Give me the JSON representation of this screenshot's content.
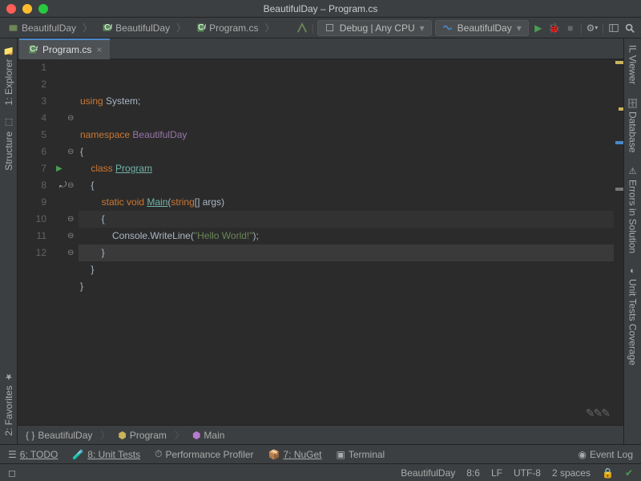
{
  "title": "BeautifulDay – Program.cs",
  "breadcrumbs": [
    "BeautifulDay",
    "BeautifulDay",
    "Program.cs"
  ],
  "config": {
    "debug": "Debug | Any CPU",
    "project": "BeautifulDay"
  },
  "tab": {
    "name": "Program.cs"
  },
  "left_tools": [
    "1: Explorer",
    "Structure",
    "2: Favorites"
  ],
  "right_tools": [
    "IL Viewer",
    "Database",
    "Errors in Solution",
    "Unit Tests Coverage"
  ],
  "code": {
    "lines": [
      {
        "n": 1,
        "tokens": [
          [
            "kw",
            "using"
          ],
          [
            "",
            " "
          ],
          [
            "cls",
            "System"
          ],
          [
            "",
            ";"
          ]
        ],
        "indent": 0
      },
      {
        "n": 2,
        "tokens": [],
        "indent": 0
      },
      {
        "n": 3,
        "tokens": [
          [
            "kw",
            "namespace"
          ],
          [
            "",
            " "
          ],
          [
            "ident",
            "BeautifulDay"
          ]
        ],
        "indent": 0
      },
      {
        "n": 4,
        "tokens": [
          [
            "",
            "{"
          ]
        ],
        "indent": 0,
        "fold": "⊖"
      },
      {
        "n": 5,
        "tokens": [
          [
            "kw",
            "class"
          ],
          [
            "",
            " "
          ],
          [
            "cls-u",
            "Program"
          ]
        ],
        "indent": 1
      },
      {
        "n": 6,
        "tokens": [
          [
            "",
            "{"
          ]
        ],
        "indent": 1,
        "fold": "⊖"
      },
      {
        "n": 7,
        "tokens": [
          [
            "kw",
            "static"
          ],
          [
            "",
            " "
          ],
          [
            "type",
            "void"
          ],
          [
            "",
            " "
          ],
          [
            "mtd",
            "Main"
          ],
          [
            "",
            "("
          ],
          [
            "type",
            "string"
          ],
          [
            "",
            "[] args)"
          ]
        ],
        "indent": 2,
        "run": true
      },
      {
        "n": 8,
        "tokens": [
          [
            "",
            "{"
          ]
        ],
        "indent": 2,
        "fold": "⊖",
        "hl": true,
        "caret": true
      },
      {
        "n": 9,
        "tokens": [
          [
            "cls",
            "Console"
          ],
          [
            "",
            "."
          ],
          [
            "",
            "WriteLine("
          ],
          [
            "str",
            "\"Hello World!\""
          ],
          [
            "",
            ");"
          ]
        ],
        "indent": 3
      },
      {
        "n": 10,
        "tokens": [
          [
            "",
            "}"
          ]
        ],
        "indent": 2,
        "fold": "⊖",
        "hl2": true
      },
      {
        "n": 11,
        "tokens": [
          [
            "",
            "}"
          ]
        ],
        "indent": 1,
        "fold": "⊖"
      },
      {
        "n": 12,
        "tokens": [
          [
            "",
            "}"
          ]
        ],
        "indent": 0,
        "fold": "⊖"
      }
    ]
  },
  "crumbs2": [
    "BeautifulDay",
    "Program",
    "Main"
  ],
  "bottom_tools": [
    "6: TODO",
    "8: Unit Tests",
    "Performance Profiler",
    "7: NuGet",
    "Terminal"
  ],
  "event_log": "Event Log",
  "status": {
    "project": "BeautifulDay",
    "pos": "8:6",
    "eol": "LF",
    "enc": "UTF-8",
    "indent": "2 spaces"
  }
}
